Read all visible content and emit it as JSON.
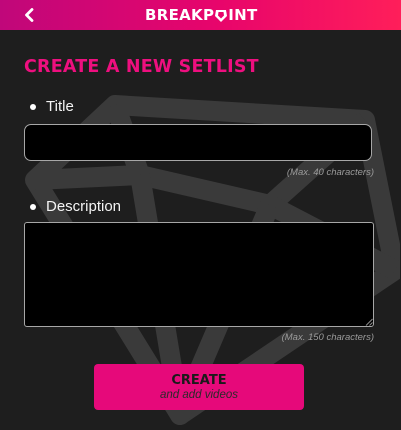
{
  "header": {
    "back_icon": "chevron-left-icon",
    "brand_prefix": "BREAKP",
    "brand_suffix": "INT",
    "brand_logo_icon": "diamond-gem-icon",
    "gradient_colors": [
      "#c0077a",
      "#ff1e5a"
    ]
  },
  "form": {
    "title": "CREATE A NEW SETLIST",
    "title_color": "#ee0f7f",
    "fields": {
      "title": {
        "label": "Title",
        "value": "",
        "hint": "(Max. 40 characters)"
      },
      "description": {
        "label": "Description",
        "value": "",
        "hint": "(Max. 150 characters)"
      }
    },
    "submit": {
      "label": "CREATE",
      "sublabel": "and add videos",
      "color": "#e6097a"
    }
  },
  "background": {
    "watermark_icon": "diamond-gem-icon"
  }
}
